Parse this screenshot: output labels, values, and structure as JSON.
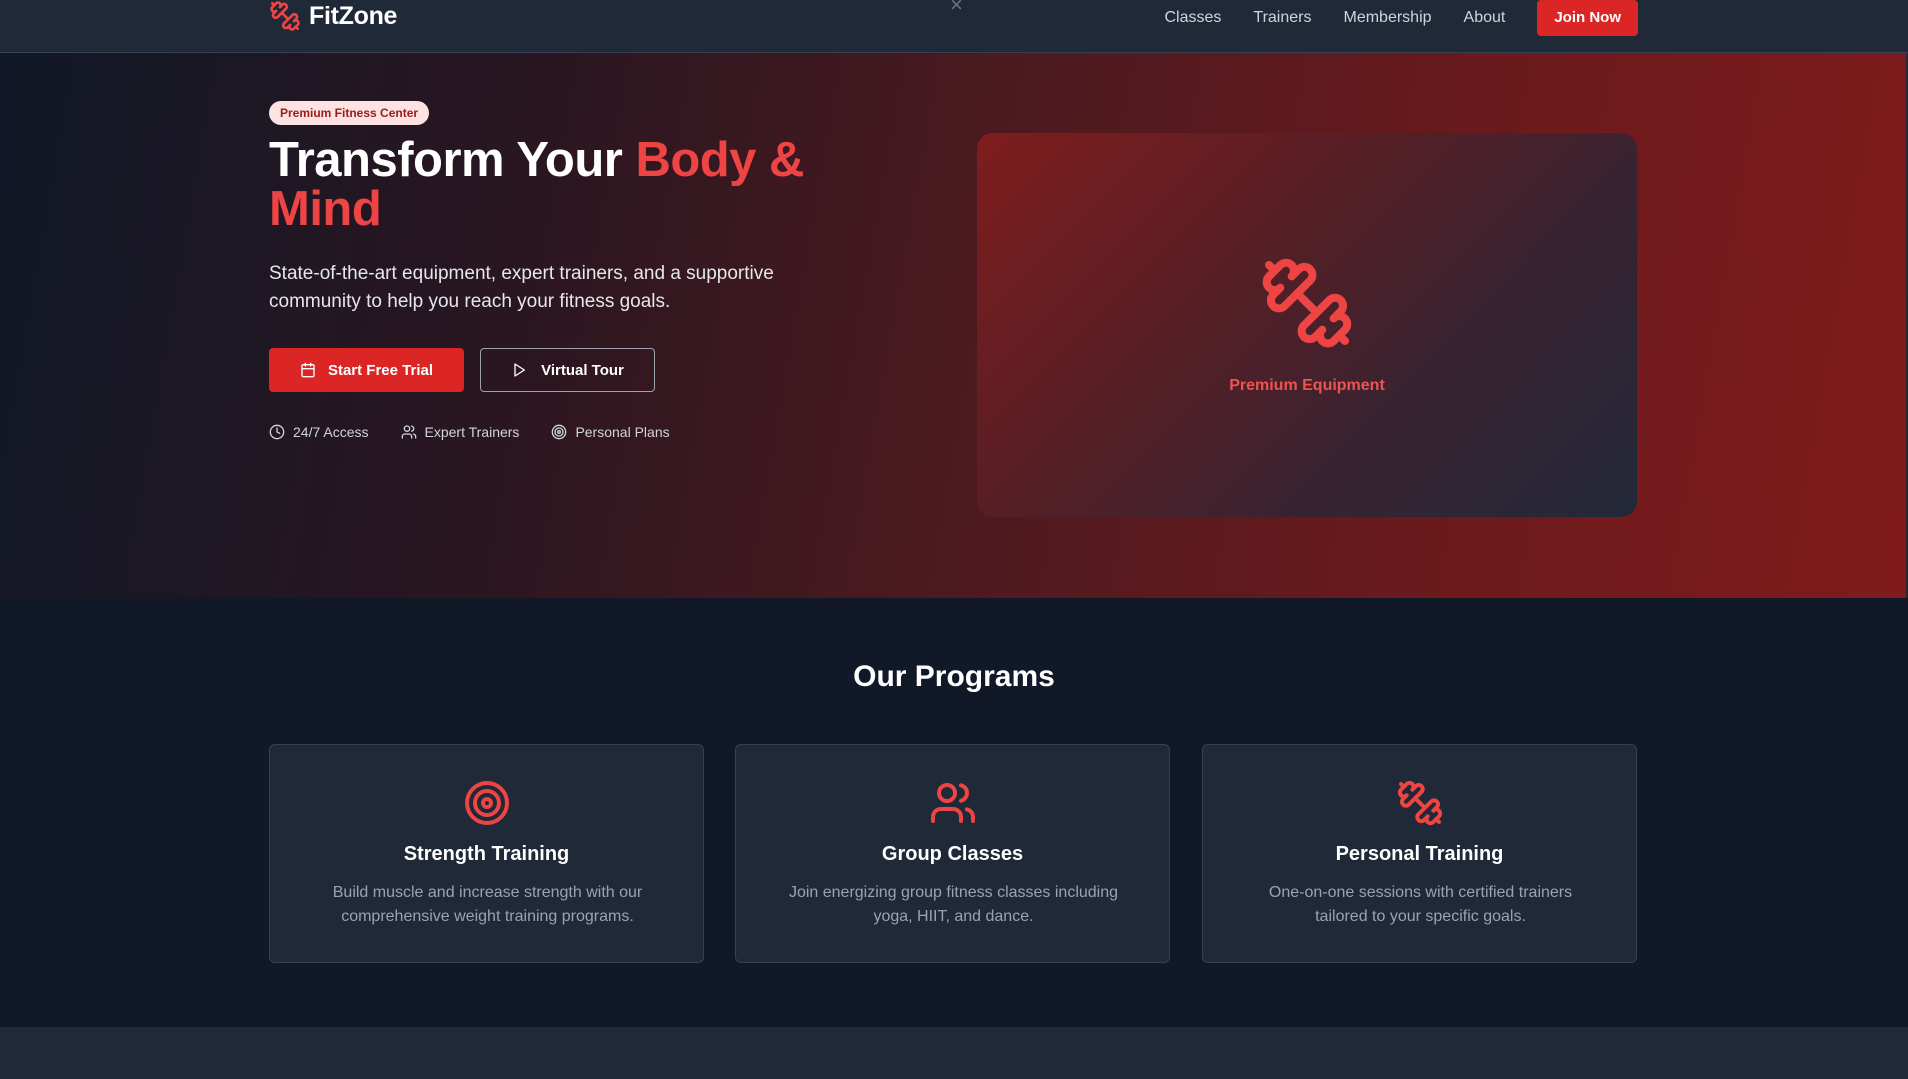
{
  "colors": {
    "accent": "#dc2626",
    "accent_text": "#ef4444",
    "bg": "#111827",
    "card": "#1f2937"
  },
  "nav": {
    "brand": "FitZone",
    "brand_icon": "dumbbell-icon",
    "links": [
      "Classes",
      "Trainers",
      "Membership",
      "About"
    ],
    "cta": "Join Now"
  },
  "hero": {
    "badge": "Premium Fitness Center",
    "title_start": "Transform Your ",
    "title_accent": "Body & Mind",
    "subtitle": "State-of-the-art equipment, expert trainers, and a supportive community to help you reach your fitness goals.",
    "primary_button": "Start Free Trial",
    "secondary_button": "Virtual Tour",
    "features": [
      "24/7 Access",
      "Expert Trainers",
      "Personal Plans"
    ],
    "card_label": "Premium Equipment"
  },
  "programs": {
    "title": "Our Programs",
    "items": [
      {
        "icon": "target-icon",
        "title": "Strength Training",
        "description": "Build muscle and increase strength with our comprehensive weight training programs."
      },
      {
        "icon": "users-icon",
        "title": "Group Classes",
        "description": "Join energizing group fitness classes including yoga, HIIT, and dance."
      },
      {
        "icon": "dumbbell-icon",
        "title": "Personal Training",
        "description": "One-on-one sessions with certified trainers tailored to your specific goals."
      }
    ]
  }
}
